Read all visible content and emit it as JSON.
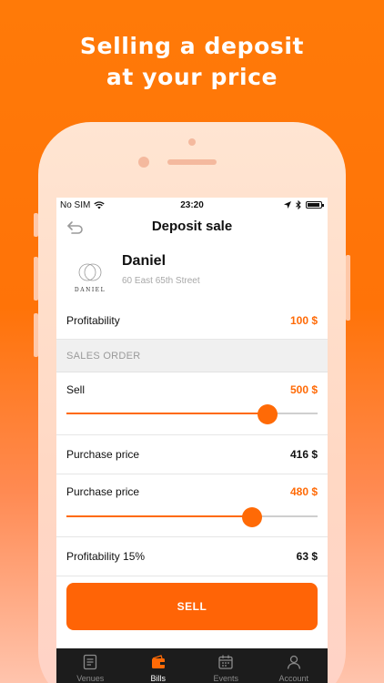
{
  "headline": {
    "line1": "Selling a deposit",
    "line2": "at your price"
  },
  "status_bar": {
    "carrier": "No SIM",
    "time": "23:20",
    "battery_level": 0.9
  },
  "nav": {
    "title": "Deposit sale",
    "back_icon": "back-arrow-icon"
  },
  "venue": {
    "name": "Daniel",
    "address": "60 East 65th Street",
    "logo_text": "DANIEL"
  },
  "profitability": {
    "label": "Profitability",
    "value": "100 $"
  },
  "section_header": "SALES ORDER",
  "sell": {
    "label": "Sell",
    "value": "500 $",
    "slider_fraction": 0.8
  },
  "purchase_price_1": {
    "label": "Purchase price",
    "value": "416 $"
  },
  "purchase_price_2": {
    "label": "Purchase price",
    "value": "480 $",
    "slider_fraction": 0.74
  },
  "profitability_pct": {
    "label": "Profitability 15%",
    "value": "63 $"
  },
  "sell_button": "SELL",
  "tabs": [
    {
      "label": "Venues",
      "icon": "menu-book-icon",
      "active": false
    },
    {
      "label": "Bills",
      "icon": "wallet-icon",
      "active": true
    },
    {
      "label": "Events",
      "icon": "calendar-icon",
      "active": false
    },
    {
      "label": "Account",
      "icon": "user-icon",
      "active": false
    }
  ],
  "colors": {
    "accent": "#ff6a06",
    "tabbar": "#1c1c1c"
  }
}
